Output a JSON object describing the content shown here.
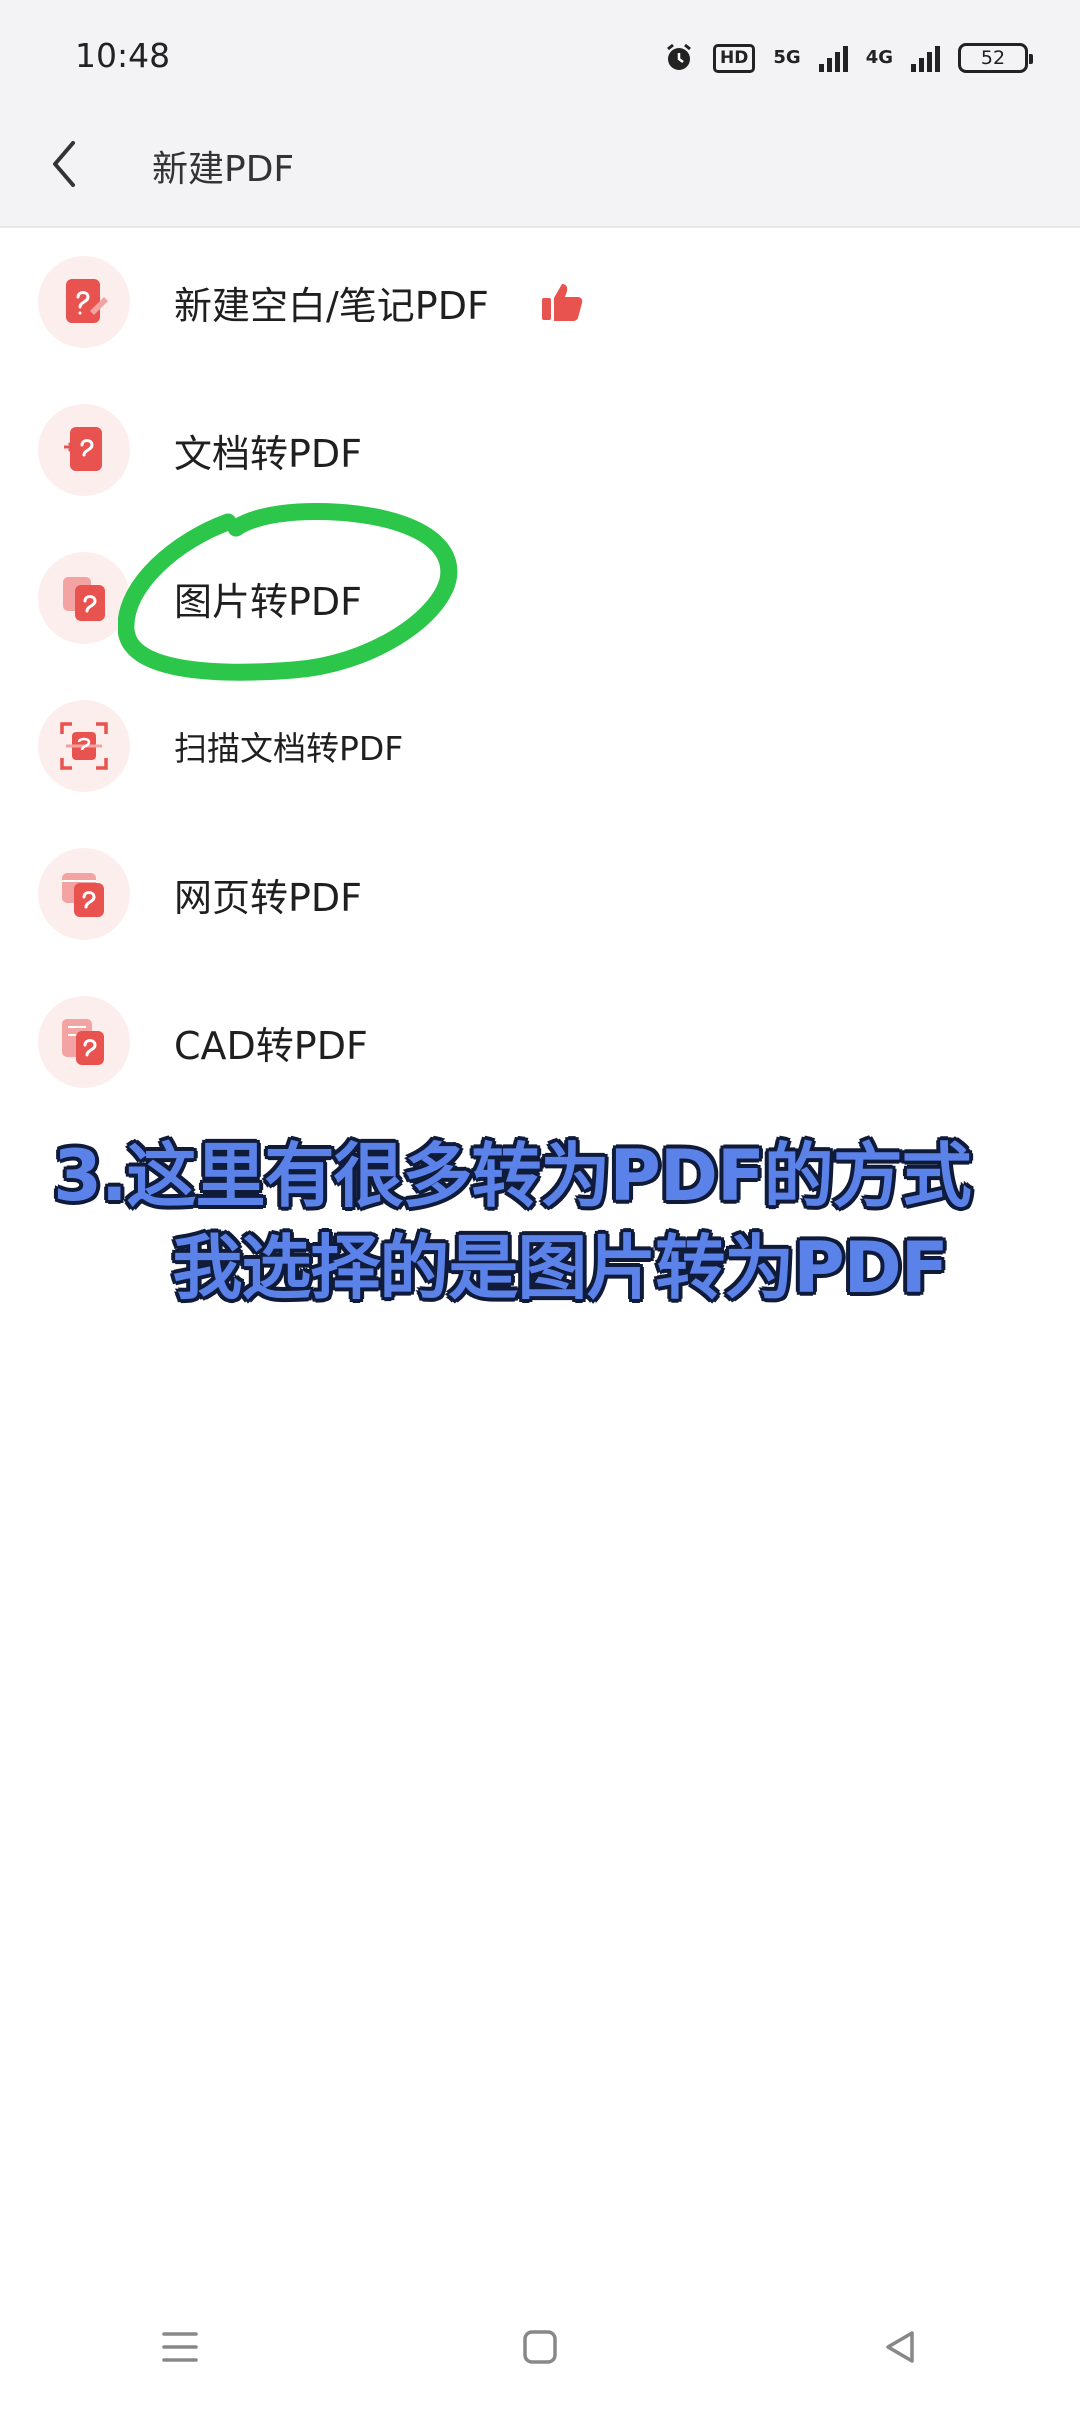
{
  "status_bar": {
    "time": "10:48",
    "hd_label": "HD",
    "net1_label": "5G",
    "net2_label": "4G",
    "battery": "52"
  },
  "header": {
    "title": "新建PDF",
    "back_icon": "chevron-left-icon"
  },
  "menu": {
    "items": [
      {
        "label": "新建空白/笔记PDF",
        "icon": "blank-pdf-icon"
      },
      {
        "label": "文档转PDF",
        "icon": "doc-to-pdf-icon"
      },
      {
        "label": "图片转PDF",
        "icon": "image-to-pdf-icon"
      },
      {
        "label": "扫描文档转PDF",
        "icon": "scan-to-pdf-icon"
      },
      {
        "label": "网页转PDF",
        "icon": "web-to-pdf-icon"
      },
      {
        "label": "CAD转PDF",
        "icon": "cad-to-pdf-icon"
      }
    ]
  },
  "caption": {
    "line1": "3.这里有很多转为PDF的方式",
    "line2": "我选择的是图片转为PDF"
  },
  "colors": {
    "accent_red": "#e8524f",
    "icon_bg": "#fdeeee",
    "annotation_green": "#2cc74a",
    "caption_blue": "#5b82e8"
  }
}
